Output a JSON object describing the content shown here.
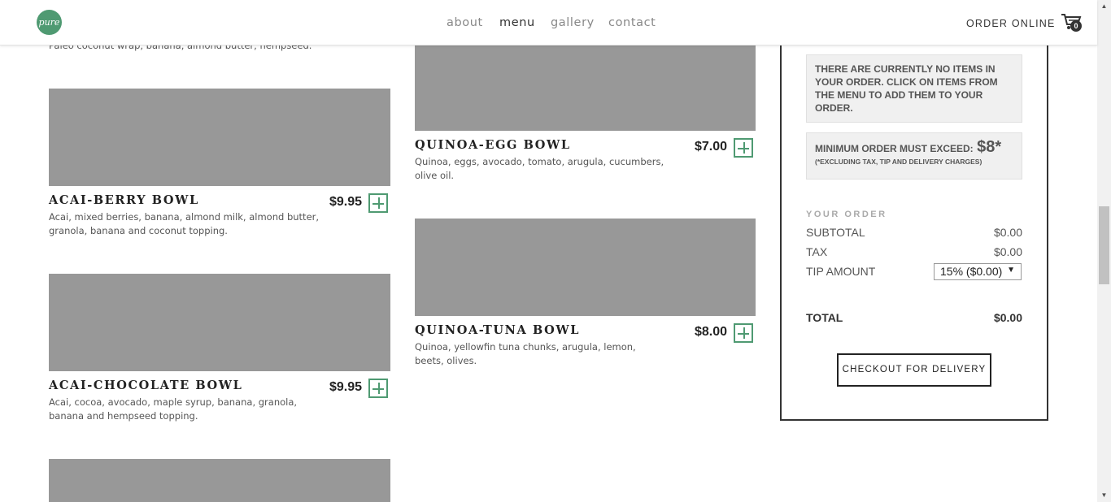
{
  "header": {
    "logo_text": "pure",
    "nav": [
      "about",
      "menu",
      "gallery",
      "contact"
    ],
    "order_online": "ORDER ONLINE",
    "cart_count": "0"
  },
  "menu": {
    "partial_desc": "Paleo coconut wrap, banana, almond butter, hempseed.",
    "items": [
      {
        "title": "ACAI-BERRY BOWL",
        "price": "$9.95",
        "desc": "Acai, mixed berries, banana, almond milk, almond butter, granola, banana and coconut topping."
      },
      {
        "title": "ACAI-CHOCOLATE BOWL",
        "price": "$9.95",
        "desc": "Acai, cocoa, avocado, maple syrup, banana, granola, banana and hempseed topping."
      },
      {
        "title": "QUINOA-EGG BOWL",
        "price": "$7.00",
        "desc": "Quinoa, eggs, avocado, tomato, arugula, cucumbers, olive oil."
      },
      {
        "title": "QUINOA-TUNA BOWL",
        "price": "$8.00",
        "desc": "Quinoa, yellowfin tuna chunks, arugula, lemon, beets, olives."
      }
    ]
  },
  "order": {
    "empty_notice": "THERE ARE CURRENTLY NO ITEMS IN YOUR ORDER. CLICK ON ITEMS FROM THE MENU TO ADD THEM TO YOUR ORDER.",
    "min_label": "MINIMUM ORDER MUST EXCEED:",
    "min_amount": "$8*",
    "min_note": "(*EXCLUDING TAX, TIP AND DELIVERY CHARGES)",
    "your_order": "YOUR ORDER",
    "subtotal_label": "SUBTOTAL",
    "subtotal": "$0.00",
    "tax_label": "TAX",
    "tax": "$0.00",
    "tip_label": "TIP AMOUNT",
    "tip_selected": "15% ($0.00)",
    "total_label": "TOTAL",
    "total": "$0.00",
    "checkout": "CHECKOUT FOR DELIVERY"
  },
  "colors": {
    "accent": "#4f9a72",
    "placeholder": "#989898"
  }
}
